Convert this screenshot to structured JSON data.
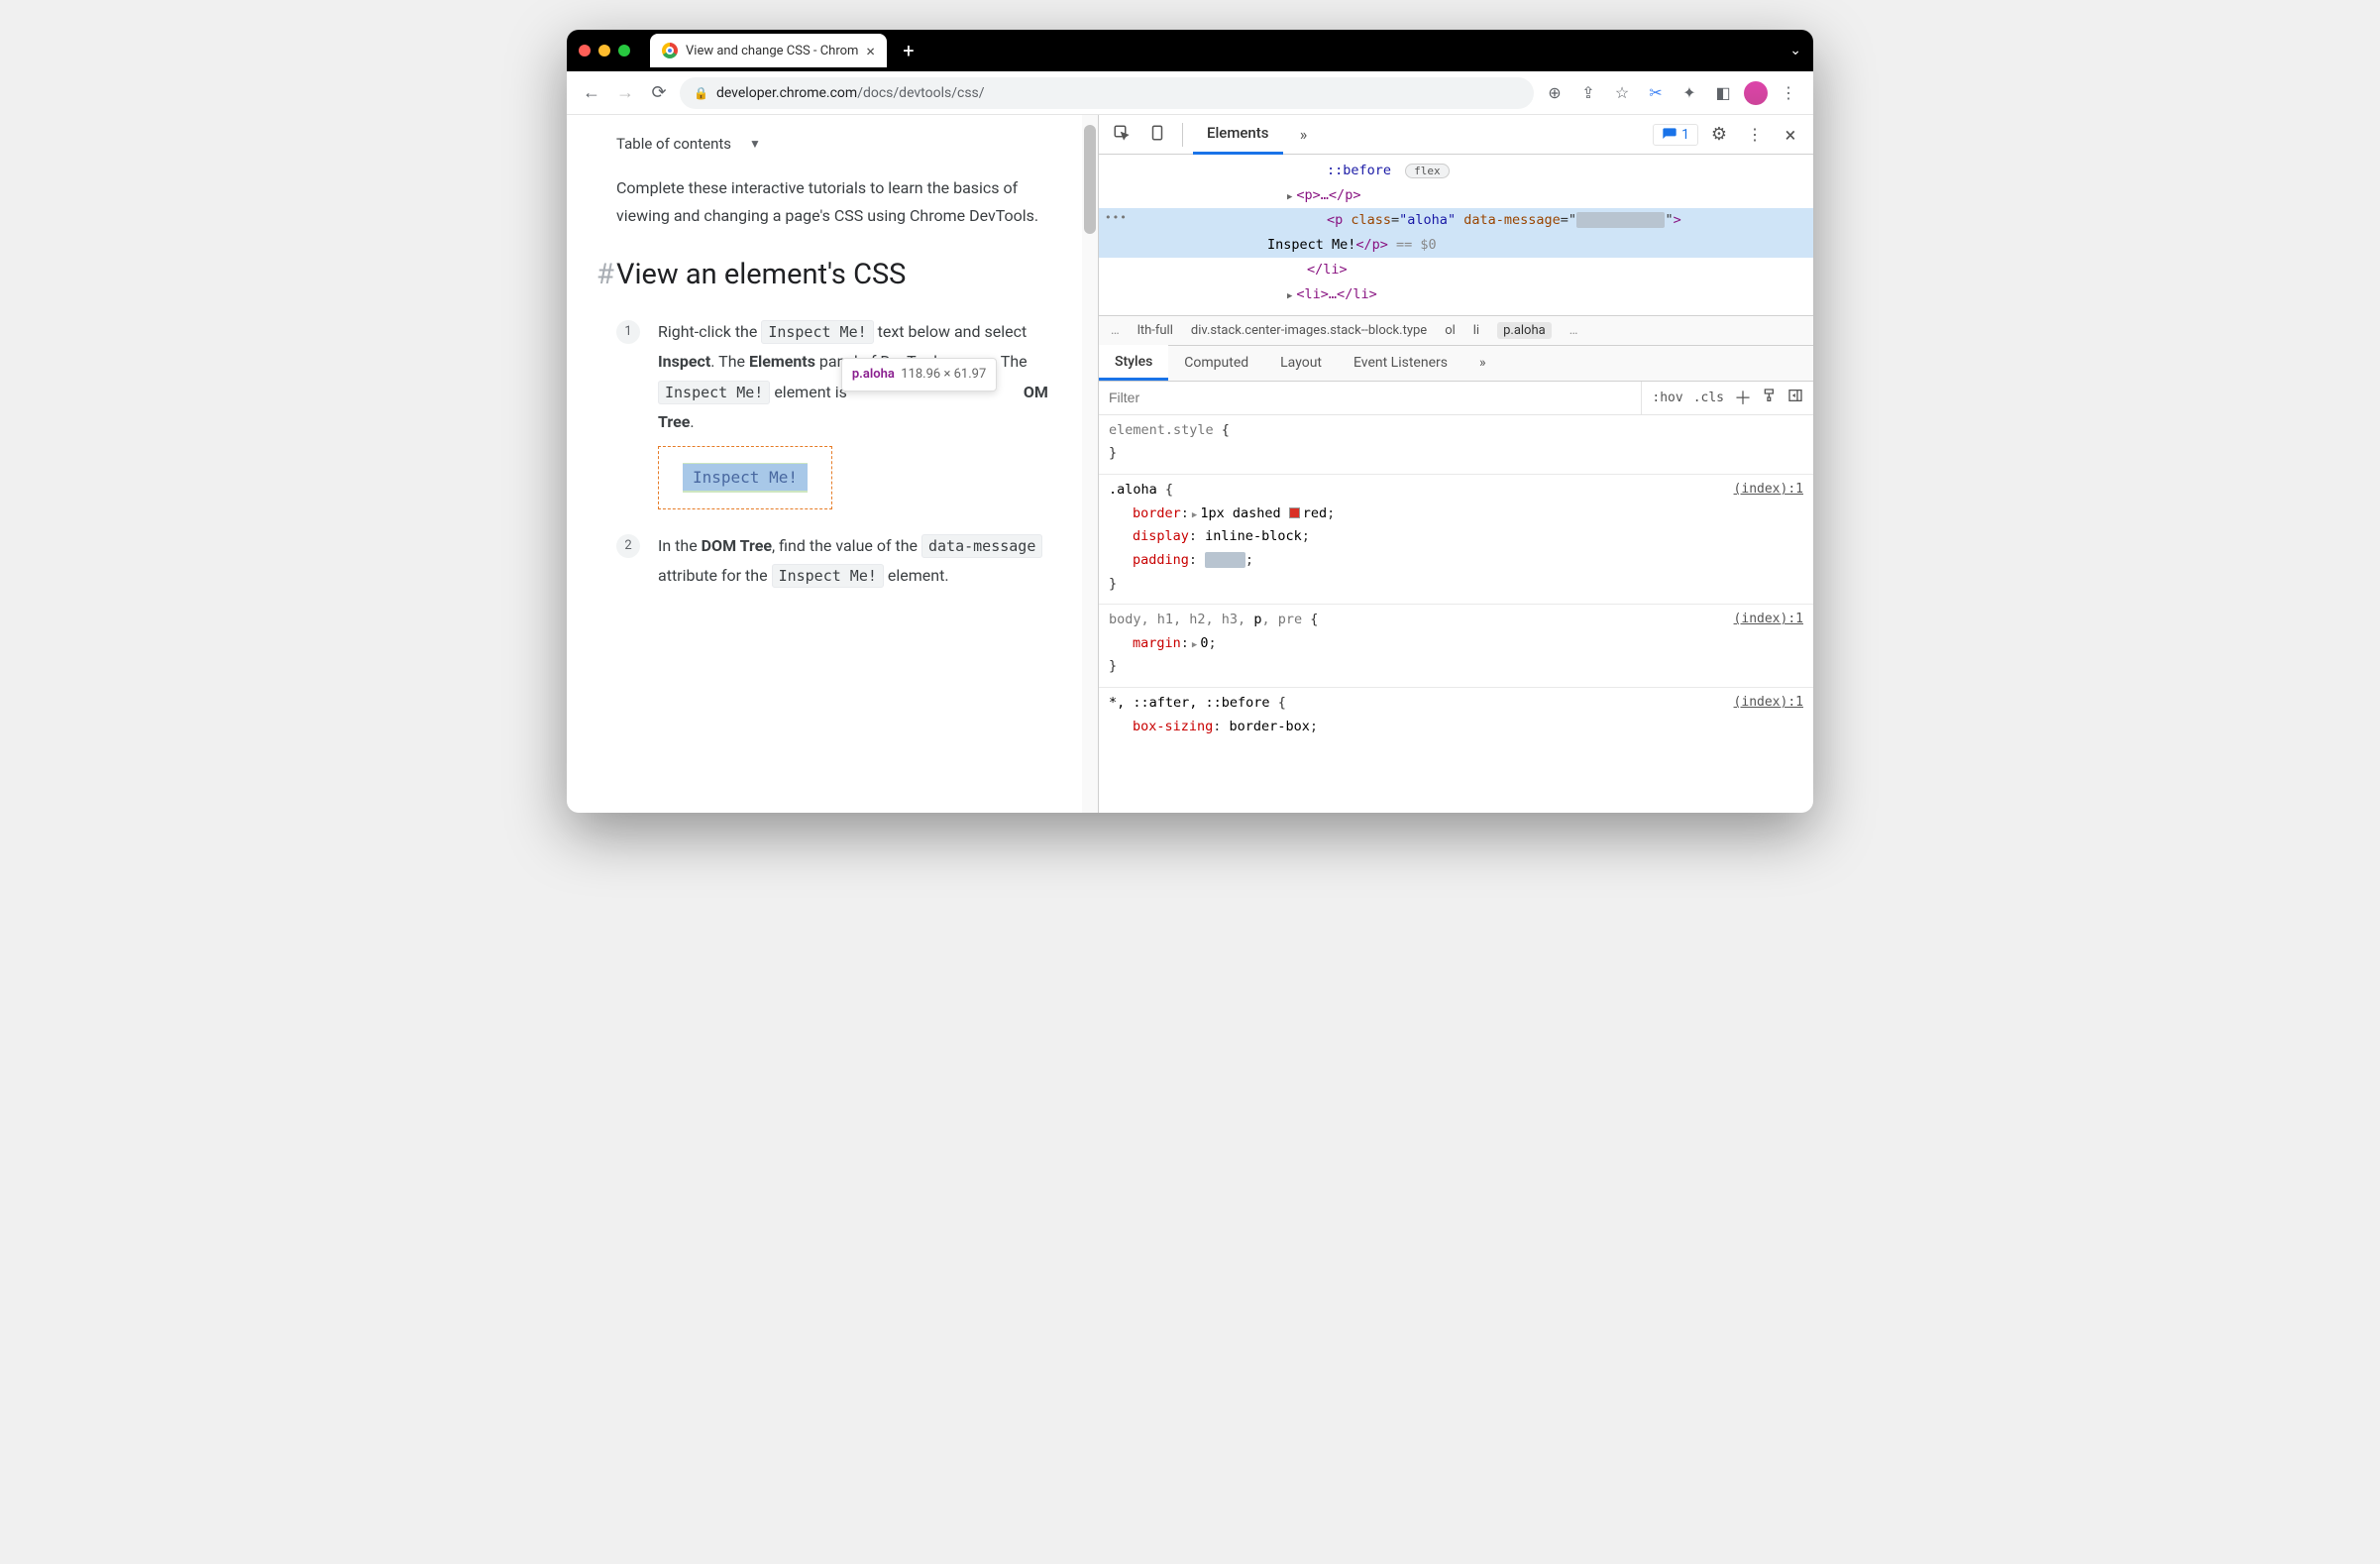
{
  "browser": {
    "tab_title": "View and change CSS - Chrom",
    "url_domain": "developer.chrome.com",
    "url_path": "/docs/devtools/css/"
  },
  "page": {
    "toc": "Table of contents",
    "intro": "Complete these interactive tutorials to learn the basics of viewing and changing a page's CSS using Chrome DevTools.",
    "heading": "View an element's CSS",
    "step1_a": "Right-click the ",
    "step1_code1": "Inspect Me!",
    "step1_b": " text below and select ",
    "step1_bold1": "Inspect",
    "step1_c": ". The ",
    "step1_bold2": "Elements",
    "step1_d": " panel of DevTools opens. The ",
    "step1_code2": "Inspect Me!",
    "step1_e": " element is",
    "step1_bold3": "OM Tree",
    "step1_f": ".",
    "inspect_text": "Inspect Me!",
    "tooltip_selector": "p.aloha",
    "tooltip_dims": "118.96 × 61.97",
    "step2_a": "In the ",
    "step2_bold1": "DOM Tree",
    "step2_b": ", find the value of the ",
    "step2_code1": "data-message",
    "step2_c": " attribute for the ",
    "step2_code2": "Inspect Me!",
    "step2_d": " element."
  },
  "devtools": {
    "tabs": {
      "elements": "Elements"
    },
    "issues_count": "1",
    "dom": {
      "before": "::before",
      "flex": "flex",
      "p_collapsed": "<p>…</p>",
      "p_open": "<p ",
      "class_attr": "class",
      "class_val": "\"aloha\"",
      "data_attr": "data-message",
      "p_close_tag": ">",
      "text": "Inspect Me!",
      "p_end": "</p>",
      "eq": " == $0",
      "li_end": "</li>",
      "li_coll": "<li>…</li>"
    },
    "crumbs": {
      "c1": "lth-full",
      "c2": "div.stack.center-images.stack--block.type",
      "c3": "ol",
      "c4": "li",
      "c5": "p.aloha"
    },
    "subtabs": {
      "styles": "Styles",
      "computed": "Computed",
      "layout": "Layout",
      "event": "Event Listeners"
    },
    "filter": {
      "placeholder": "Filter",
      "hov": ":hov",
      "cls": ".cls"
    },
    "rules": {
      "es_sel": "element.style",
      "brace_o": " {",
      "brace_c": "}",
      "aloha_sel": ".aloha",
      "src1": "(index):1",
      "border_p": "border",
      "border_v": "1px dashed ",
      "border_color": "red",
      "display_p": "display",
      "display_v": "inline-block",
      "padding_p": "padding",
      "body_sel_g": "body, h1, h2, h3, ",
      "body_sel_b": "p",
      "body_sel_g2": ", pre",
      "margin_p": "margin",
      "margin_v": "0",
      "univ_sel": "*, ::after, ::before",
      "bs_p": "box-sizing",
      "bs_v": "border-box"
    }
  }
}
